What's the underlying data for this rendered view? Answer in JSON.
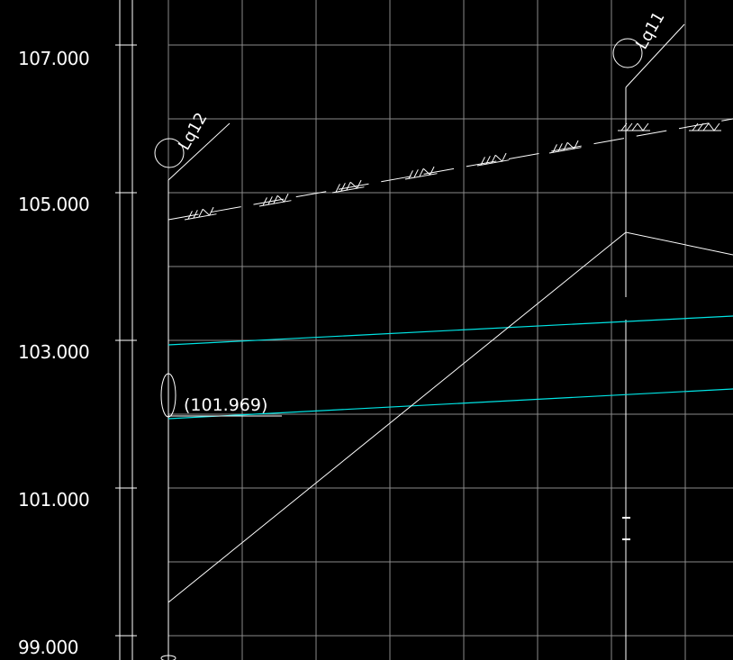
{
  "drawing": {
    "background": "#000000",
    "grid_color": "#8a8a8a",
    "line_color": "#ffffff",
    "pipe_color": "#00e5e5",
    "elevation_axis": {
      "labels": [
        "107.000",
        "105.000",
        "103.000",
        "101.000",
        "99.000"
      ]
    },
    "wells": [
      {
        "id": "lq12",
        "label": "Lq12"
      },
      {
        "id": "lq11",
        "label": "Lq11"
      }
    ],
    "pipe_annotation": "(101.969)",
    "ground_line": "dashed-with-hatch",
    "pipe_lines": [
      "upper",
      "lower"
    ]
  }
}
